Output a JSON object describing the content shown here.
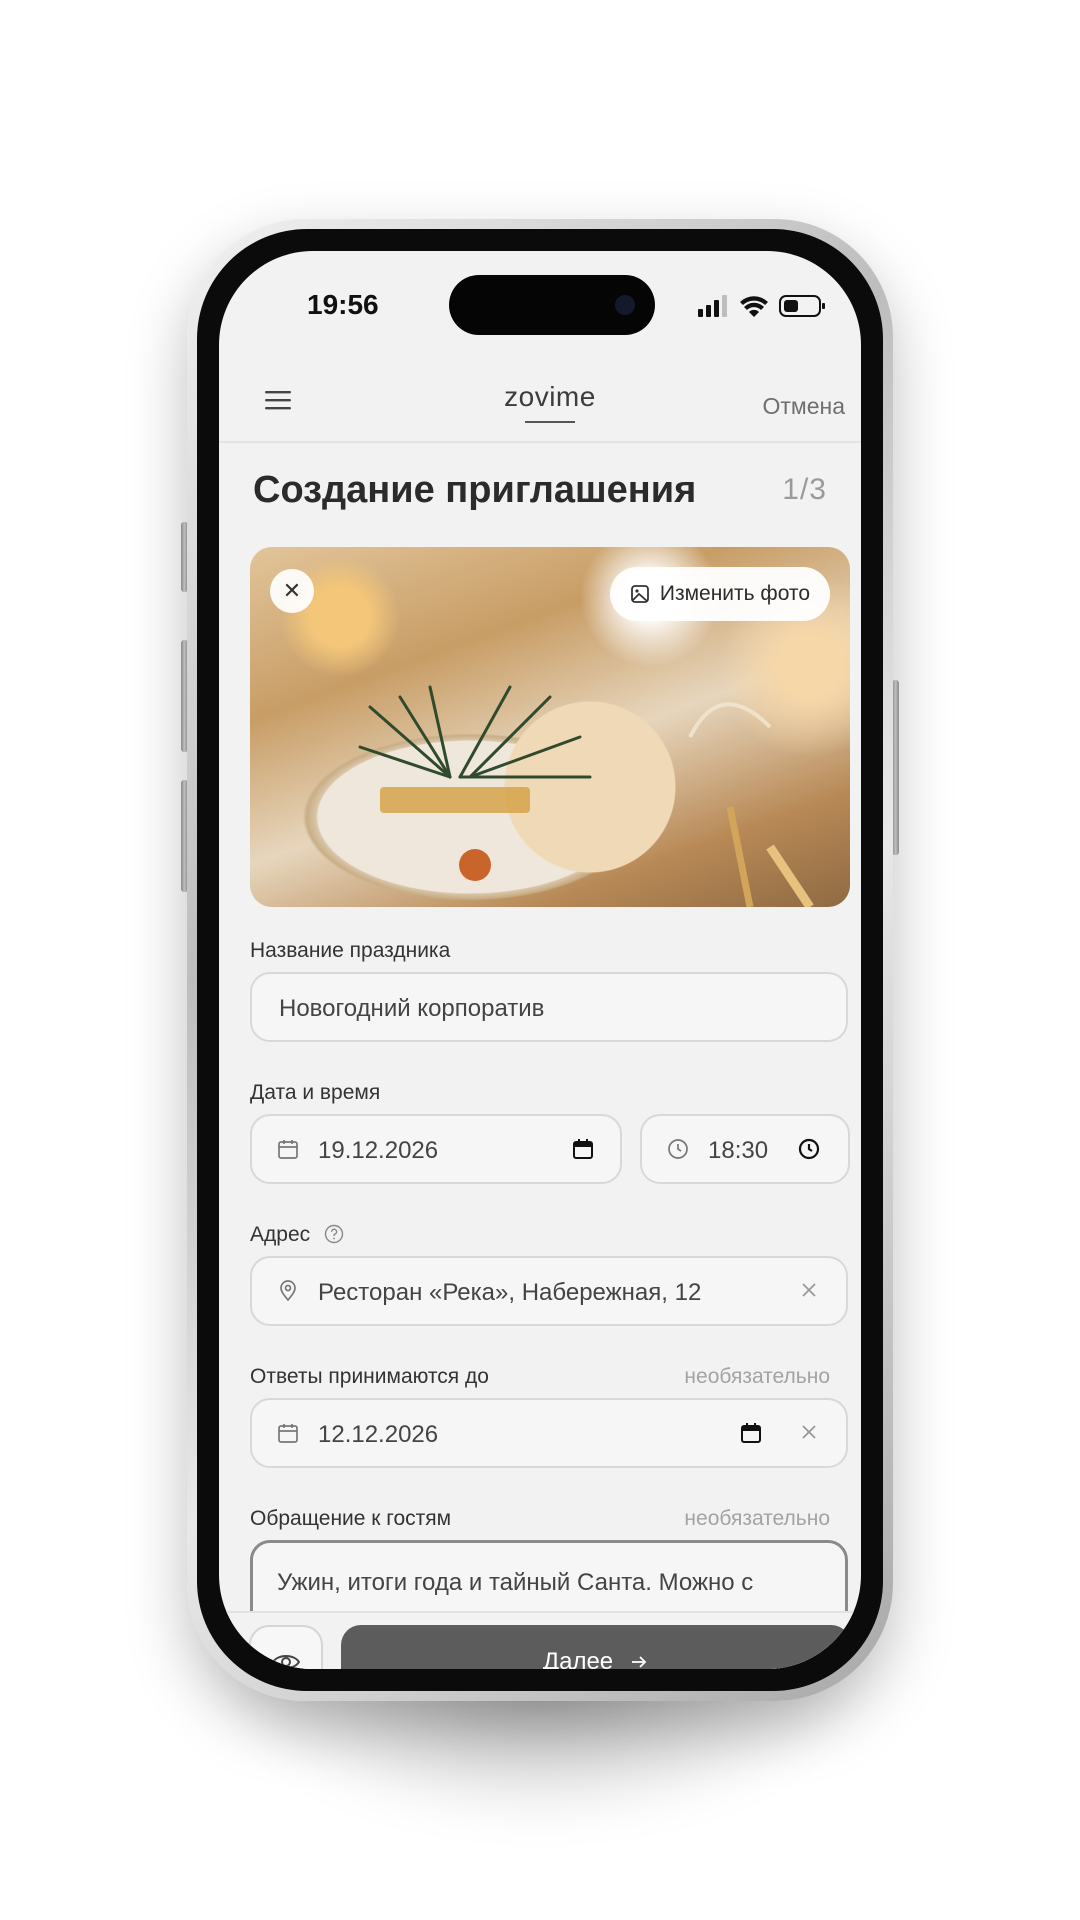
{
  "status_bar": {
    "time": "19:56"
  },
  "header": {
    "logo": "zovime",
    "cancel_label": "Отмена"
  },
  "page": {
    "title": "Создание приглашения",
    "step": "1/3"
  },
  "photo": {
    "change_label": "Изменить фото"
  },
  "form": {
    "name": {
      "label": "Название праздника",
      "value": "Новогодний корпоратив"
    },
    "datetime": {
      "label": "Дата и время",
      "date": "19.12.2026",
      "time": "18:30"
    },
    "address": {
      "label": "Адрес",
      "value": "Ресторан «Река», Набережная, 12"
    },
    "deadline": {
      "label": "Ответы принимаются до",
      "optional": "необязательно",
      "value": "12.12.2026"
    },
    "message": {
      "label": "Обращение к гостям",
      "optional": "необязательно",
      "value": "Ужин, итоги года и тайный Санта. Можно с"
    }
  },
  "actions": {
    "next_label": "Далее"
  },
  "colors": {
    "primary_button": "#5c5c5c",
    "screen_bg": "#f2f2f2"
  }
}
